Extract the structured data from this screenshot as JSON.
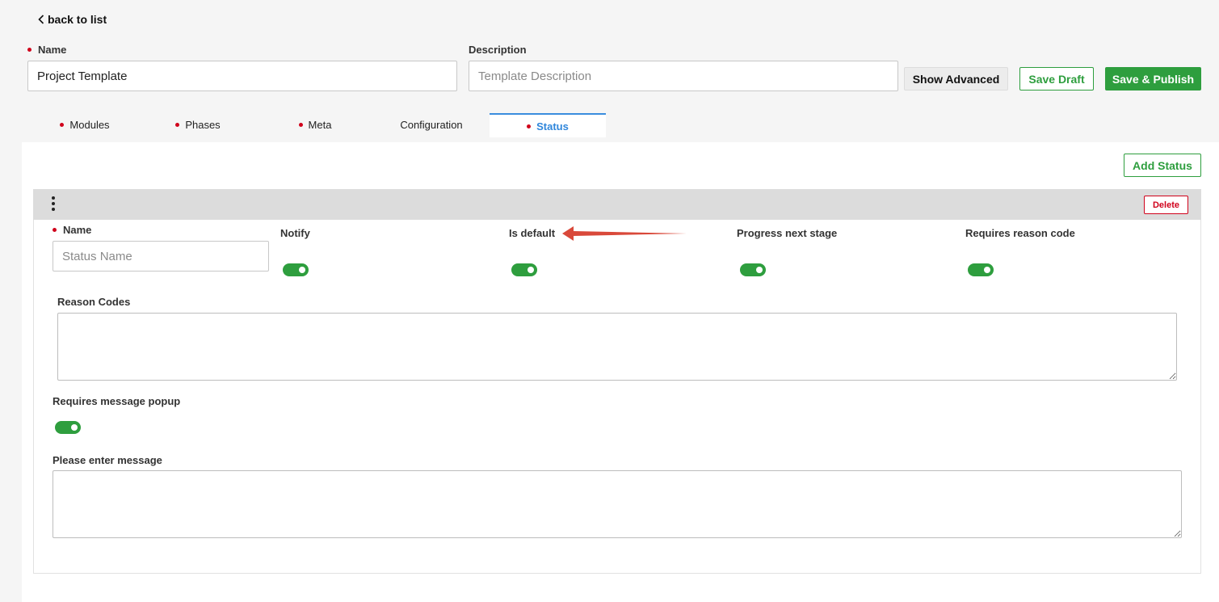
{
  "header": {
    "back_label": "back to list"
  },
  "form": {
    "name_label": "Name",
    "name_value": "Project Template",
    "description_label": "Description",
    "description_placeholder": "Template Description"
  },
  "toolbar": {
    "show_advanced": "Show Advanced",
    "save_draft": "Save Draft",
    "save_publish": "Save & Publish"
  },
  "tabs": [
    {
      "label": "Modules",
      "required": true
    },
    {
      "label": "Phases",
      "required": true
    },
    {
      "label": "Meta",
      "required": true
    },
    {
      "label": "Configuration",
      "required": false
    },
    {
      "label": "Status",
      "required": true,
      "active": true
    }
  ],
  "status_panel": {
    "add_status": "Add Status",
    "card": {
      "delete_label": "Delete",
      "name_label": "Name",
      "name_placeholder": "Status Name",
      "toggles": [
        {
          "label": "Notify",
          "on": true
        },
        {
          "label": "Is default",
          "on": true
        },
        {
          "label": "Progress next stage",
          "on": true
        },
        {
          "label": "Requires reason code",
          "on": true
        }
      ],
      "reason_codes_label": "Reason Codes",
      "message_popup_label": "Requires message popup",
      "message_popup_on": true,
      "message_label": "Please enter message"
    }
  },
  "colors": {
    "accent_green": "#2e9e3e",
    "required_red": "#d0021b",
    "active_tab_blue": "#2f86db",
    "annotation_arrow": "#d9493a"
  }
}
